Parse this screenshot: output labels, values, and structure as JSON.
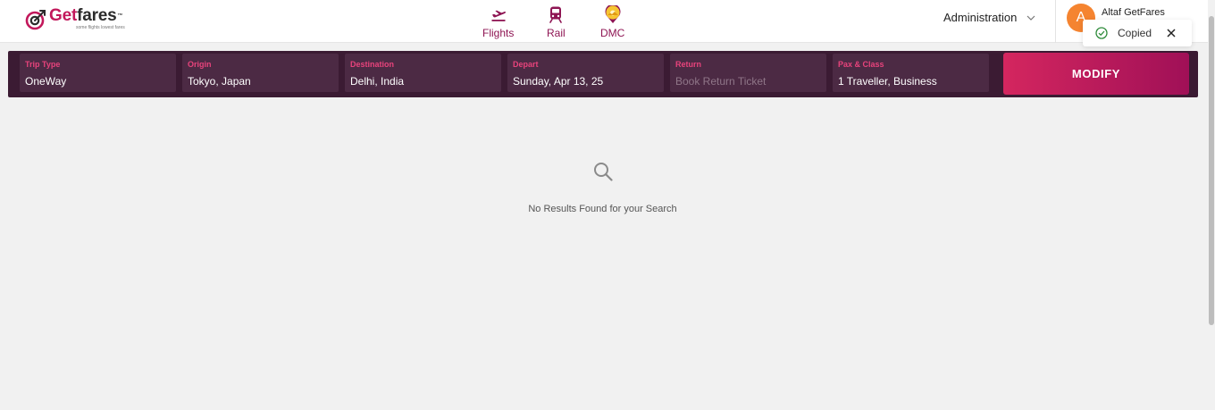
{
  "brand": {
    "name_part1": "Get",
    "name_part2": "fares",
    "trademark": "™",
    "tagline": "some flights lowest fares",
    "accent_color": "#c2185b",
    "secondary_color": "#8e1553"
  },
  "nav": {
    "flights": {
      "label": "Flights",
      "icon": "plane-departure-icon"
    },
    "rail": {
      "label": "Rail",
      "icon": "train-icon"
    },
    "dmc": {
      "label": "DMC",
      "icon": "map-pin-sun-icon"
    }
  },
  "account": {
    "menu_label": "Administration",
    "avatar_initial": "A",
    "user_name": "Altaf GetFares",
    "avatar_color": "#f58430"
  },
  "toast": {
    "message": "Copied",
    "icon": "check-circle-icon"
  },
  "search": {
    "trip_type": {
      "label": "Trip Type",
      "value": "OneWay"
    },
    "origin": {
      "label": "Origin",
      "value": "Tokyo, Japan"
    },
    "destination": {
      "label": "Destination",
      "value": "Delhi, India"
    },
    "depart": {
      "label": "Depart",
      "value": "Sunday, Apr 13, 25"
    },
    "return": {
      "label": "Return",
      "placeholder": "Book Return Ticket"
    },
    "pax_class": {
      "label": "Pax & Class",
      "value": "1 Traveller, Business"
    },
    "modify_label": "MODIFY",
    "bar_color": "#3b1b33",
    "field_color": "#4c2a44"
  },
  "results": {
    "empty_message": "No Results Found for your Search",
    "icon": "search-icon"
  }
}
